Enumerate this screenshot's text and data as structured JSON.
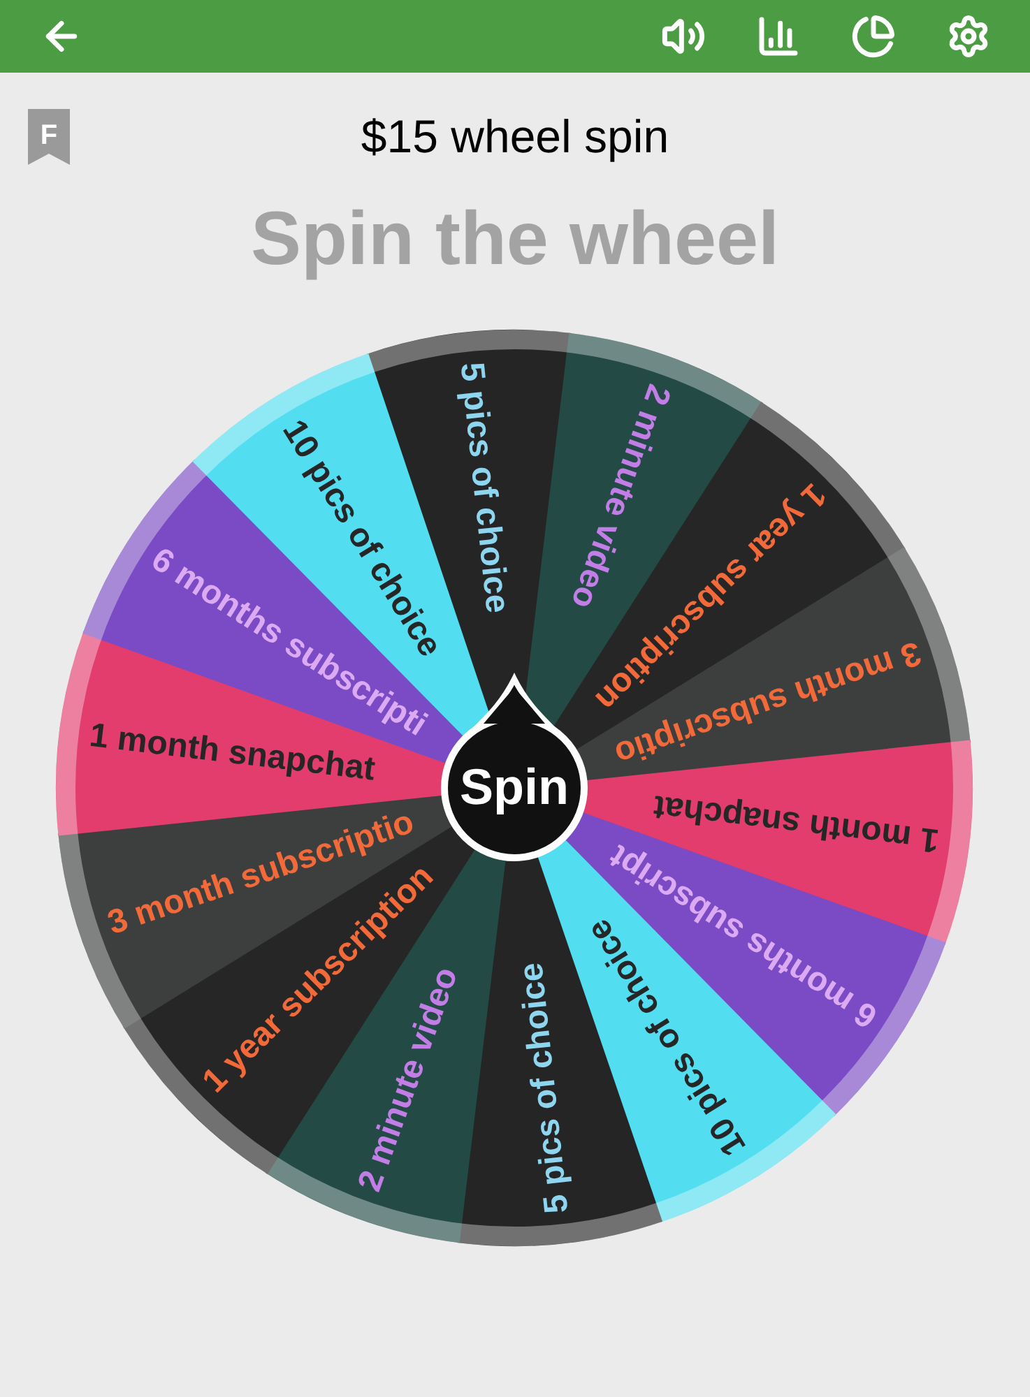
{
  "header": {
    "badge": "F",
    "title": "$15 wheel spin"
  },
  "heading": "Spin the wheel",
  "wheel": {
    "center_label": "Spin",
    "segments": [
      {
        "label": "5 pics of choice",
        "color": "#252525"
      },
      {
        "label": "2 minute video",
        "color": "#234a45"
      },
      {
        "label": "1 year subscription",
        "color": "#262626"
      },
      {
        "label": "3 month subscriptio",
        "color": "#3d3f3f"
      },
      {
        "label": "1 month snapchat",
        "color": "#e33d6e"
      },
      {
        "label": "6 months subscript",
        "color": "#7a4bc4"
      },
      {
        "label": "10 pics of choice",
        "color": "#52def0"
      },
      {
        "label": "5 pics of choice",
        "color": "#252525"
      },
      {
        "label": "2 minute video",
        "color": "#234a45"
      },
      {
        "label": "1 year subscription",
        "color": "#262626"
      },
      {
        "label": "3 month subscriptio",
        "color": "#3d3f3f"
      },
      {
        "label": "1 month snapchat",
        "color": "#e33d6e"
      },
      {
        "label": "6 months subscripti",
        "color": "#7a4bc4"
      },
      {
        "label": "10 pics of choice",
        "color": "#52def0"
      }
    ]
  }
}
